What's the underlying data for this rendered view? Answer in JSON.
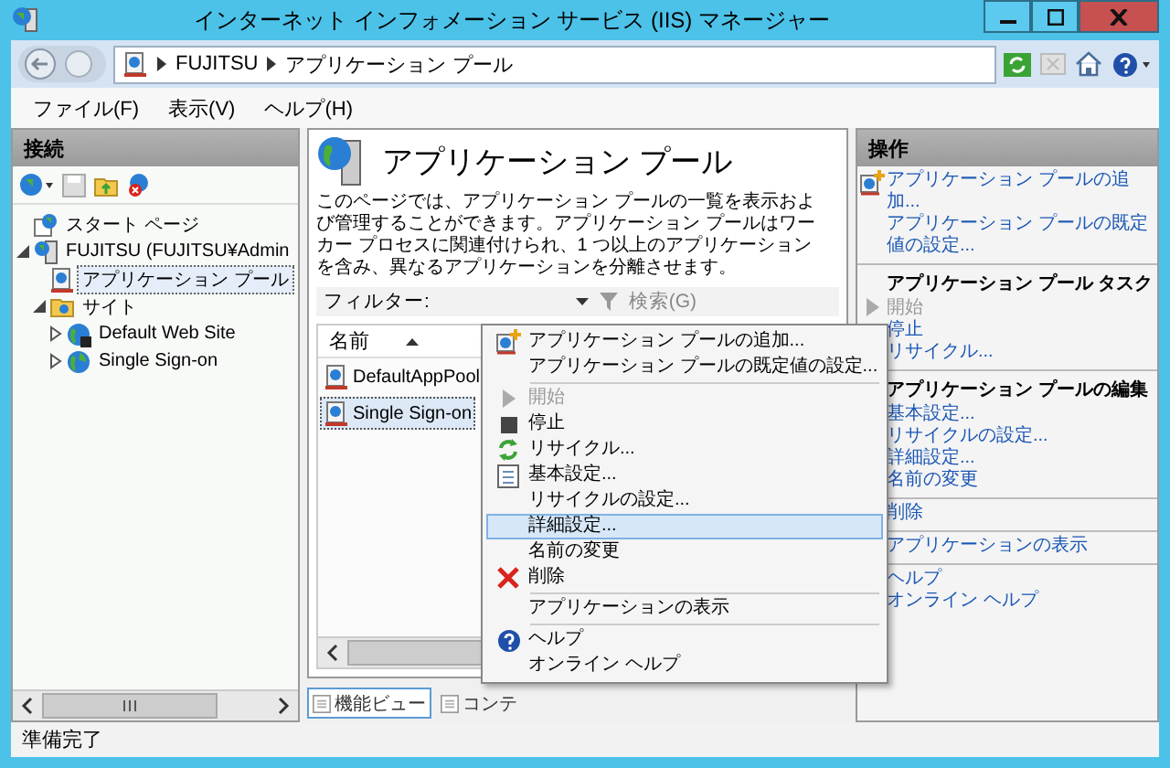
{
  "window": {
    "title": "インターネット インフォメーション サービス (IIS) マネージャー"
  },
  "address_bar": {
    "breadcrumb": [
      "FUJITSU",
      "アプリケーション プール"
    ]
  },
  "menu": [
    "ファイル(F)",
    "表示(V)",
    "ヘルプ(H)"
  ],
  "connections": {
    "title": "接続",
    "tree": [
      {
        "label": "スタート ページ",
        "kind": "start",
        "selected": false
      },
      {
        "label": "FUJITSU (FUJITSU¥Admin",
        "kind": "server",
        "expanded": true,
        "selected": false,
        "children": [
          {
            "label": "アプリケーション プール",
            "kind": "pool",
            "selected": true
          },
          {
            "label": "サイト",
            "kind": "sites",
            "expanded": true,
            "selected": false,
            "children": [
              {
                "label": "Default Web Site",
                "kind": "site_stopped",
                "expanded": false,
                "selected": false
              },
              {
                "label": "Single Sign-on",
                "kind": "site",
                "expanded": false,
                "selected": false
              }
            ]
          }
        ]
      }
    ]
  },
  "center": {
    "title": "アプリケーション プール",
    "description": "このページでは、アプリケーション プールの一覧を表示および管理することができます。アプリケーション プールはワーカー プロセスに関連付けられ、1 つ以上のアプリケーションを含み、異なるアプリケーションを分離させます。",
    "filter_label": "フィルター:",
    "search_label": "検索(G)",
    "column": "名前",
    "rows": [
      {
        "name": "DefaultAppPool",
        "selected": false
      },
      {
        "name": "Single Sign-on",
        "selected": true
      }
    ],
    "view_tabs": [
      {
        "label": "機能ビュー",
        "selected": true
      },
      {
        "label": "コンテ",
        "selected": false
      }
    ]
  },
  "actions": {
    "title": "操作",
    "sections": [
      {
        "items": [
          {
            "label": "アプリケーション プールの追加...",
            "kind": "add",
            "disabled": false
          },
          {
            "label": "アプリケーション プールの既定値の設定...",
            "kind": "link",
            "disabled": false
          }
        ]
      },
      {
        "heading": "アプリケーション プール タスク",
        "items": [
          {
            "label": "開始",
            "kind": "start",
            "disabled": true
          },
          {
            "label": "停止",
            "kind": "link",
            "disabled": false
          },
          {
            "label": "リサイクル...",
            "kind": "link",
            "disabled": false
          }
        ]
      },
      {
        "heading": "アプリケーション プールの編集",
        "items": [
          {
            "label": "基本設定...",
            "kind": "link",
            "disabled": false
          },
          {
            "label": "リサイクルの設定...",
            "kind": "link",
            "disabled": false
          },
          {
            "label": "詳細設定...",
            "kind": "link",
            "disabled": false
          },
          {
            "label": "名前の変更",
            "kind": "link",
            "disabled": false
          }
        ]
      },
      {
        "items": [
          {
            "label": "削除",
            "kind": "link",
            "disabled": false
          }
        ]
      },
      {
        "items": [
          {
            "label": "アプリケーションの表示",
            "kind": "link",
            "disabled": false
          }
        ]
      },
      {
        "items": [
          {
            "label": "ヘルプ",
            "kind": "link",
            "disabled": false
          },
          {
            "label": "オンライン ヘルプ",
            "kind": "link",
            "disabled": false
          }
        ]
      }
    ]
  },
  "context_menu": {
    "sections": [
      [
        {
          "label": "アプリケーション プールの追加...",
          "kind": "add",
          "disabled": false,
          "selected": false
        },
        {
          "label": "アプリケーション プールの既定値の設定...",
          "kind": "none",
          "disabled": false,
          "selected": false
        }
      ],
      [
        {
          "label": "開始",
          "kind": "start",
          "disabled": true,
          "selected": false
        },
        {
          "label": "停止",
          "kind": "stop",
          "disabled": false,
          "selected": false
        },
        {
          "label": "リサイクル...",
          "kind": "recycle",
          "disabled": false,
          "selected": false
        },
        {
          "label": "基本設定...",
          "kind": "basic",
          "disabled": false,
          "selected": false
        },
        {
          "label": "リサイクルの設定...",
          "kind": "none",
          "disabled": false,
          "selected": false
        },
        {
          "label": "詳細設定...",
          "kind": "none",
          "disabled": false,
          "selected": true
        },
        {
          "label": "名前の変更",
          "kind": "none",
          "disabled": false,
          "selected": false
        },
        {
          "label": "削除",
          "kind": "delete",
          "disabled": false,
          "selected": false
        }
      ],
      [
        {
          "label": "アプリケーションの表示",
          "kind": "none",
          "disabled": false,
          "selected": false
        }
      ],
      [
        {
          "label": "ヘルプ",
          "kind": "help",
          "disabled": false,
          "selected": false
        },
        {
          "label": "オンライン ヘルプ",
          "kind": "none",
          "disabled": false,
          "selected": false
        }
      ]
    ]
  },
  "status_bar": {
    "text": "準備完了"
  }
}
